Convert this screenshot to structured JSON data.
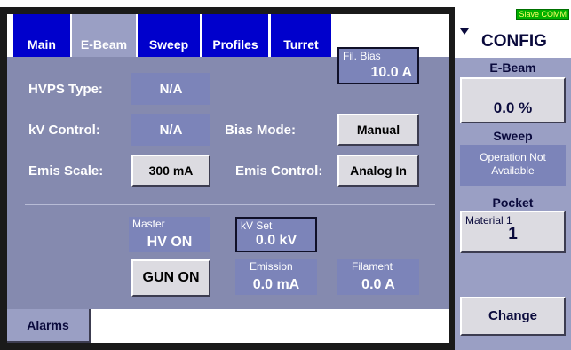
{
  "tabs": [
    {
      "label": "Main",
      "active": false
    },
    {
      "label": "E-Beam",
      "active": true
    },
    {
      "label": "Sweep",
      "active": false
    },
    {
      "label": "Profiles",
      "active": false
    },
    {
      "label": "Turret",
      "active": false
    }
  ],
  "ebeam": {
    "hvps_type_label": "HVPS Type:",
    "hvps_type_value": "N/A",
    "kv_control_label": "kV Control:",
    "kv_control_value": "N/A",
    "emis_scale_label": "Emis Scale:",
    "emis_scale_value": "300 mA",
    "fil_bias_caption": "Fil. Bias",
    "fil_bias_value": "10.0 A",
    "bias_mode_label": "Bias Mode:",
    "bias_mode_value": "Manual",
    "emis_control_label": "Emis Control:",
    "emis_control_value": "Analog In",
    "master_caption": "Master",
    "master_value": "HV ON",
    "kv_set_caption": "kV Set",
    "kv_set_value": "0.0 kV",
    "gun_button": "GUN ON",
    "emission_caption": "Emission",
    "emission_value": "0.0 mA",
    "filament_caption": "Filament",
    "filament_value": "0.0 A"
  },
  "bottom": {
    "alarms_label": "Alarms"
  },
  "sidebar": {
    "slave_badge": "Slave COMM",
    "title": "CONFIG",
    "ebeam_header": "E-Beam",
    "ebeam_value": "0.0 %",
    "sweep_header": "Sweep",
    "sweep_status": "Operation Not Available",
    "pocket_header": "Pocket",
    "pocket_material": "Material 1",
    "pocket_number": "1",
    "change_button": "Change"
  },
  "colors": {
    "tab_blue": "#0000cc",
    "active_tab": "#9a9fc4",
    "panel": "#858aaf",
    "readout": "#7c84b9",
    "slave_green": "#00b000"
  },
  "icons": {
    "config_dropdown": "chevron-down-icon"
  }
}
